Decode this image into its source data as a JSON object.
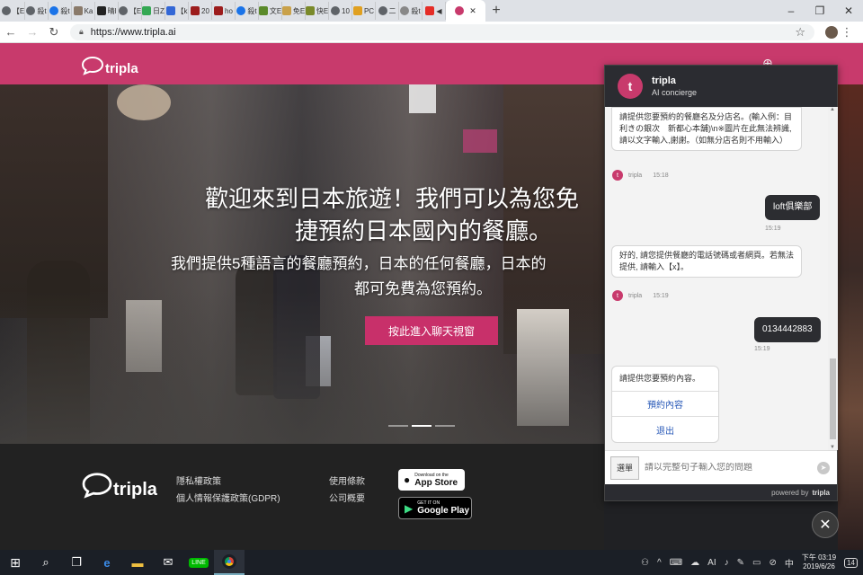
{
  "browser": {
    "tabs": [
      {
        "label": "【E",
        "icon": "chrome-icon",
        "color": "#5f6368"
      },
      {
        "label": "殺t",
        "icon": "chrome-icon",
        "color": "#5f6368"
      },
      {
        "label": "殺t",
        "icon": "globe-blue-icon",
        "color": "#1a73e8"
      },
      {
        "label": "Ka",
        "icon": "image-icon",
        "color": "#8a7a6a"
      },
      {
        "label": "晴l",
        "icon": "ufo-icon",
        "color": "#222222"
      },
      {
        "label": "【E",
        "icon": "chrome-icon",
        "color": "#5f6368"
      },
      {
        "label": "日Z",
        "icon": "drive-icon",
        "color": "#34a853"
      },
      {
        "label": "【k",
        "icon": "blue-square-icon",
        "color": "#3367d6"
      },
      {
        "label": "20",
        "icon": "red-square-icon",
        "color": "#9c1c1c"
      },
      {
        "label": "ho",
        "icon": "red-square-icon",
        "color": "#9c1c1c"
      },
      {
        "label": "殺t",
        "icon": "globe-blue-icon",
        "color": "#1a73e8"
      },
      {
        "label": "文E",
        "icon": "green-square-icon",
        "color": "#5a8a2a"
      },
      {
        "label": "免E",
        "icon": "flower-icon",
        "color": "#c9a14a"
      },
      {
        "label": "快E",
        "icon": "olive-square-icon",
        "color": "#7a8a2a"
      },
      {
        "label": "10",
        "icon": "chrome-icon",
        "color": "#5f6368"
      },
      {
        "label": "PC",
        "icon": "bars-icon",
        "color": "#e0a020"
      },
      {
        "label": "二",
        "icon": "chrome-icon",
        "color": "#5f6368"
      },
      {
        "label": "殺t",
        "icon": "globe-gray-icon",
        "color": "#888888"
      },
      {
        "label": "◀",
        "icon": "youtube-icon",
        "color": "#e52d27"
      }
    ],
    "active_tab_icon": "tripla-favicon",
    "url": "https://www.tripla.ai",
    "new_tab": "+",
    "window_minimize": "–",
    "window_maximize": "❐",
    "window_close": "✕"
  },
  "site": {
    "brand": "tripla",
    "accent": "#c83a6c",
    "hero_title_line1": "歡迎來到日本旅遊！我們可以為您免",
    "hero_title_line2": "捷預約日本國內的餐廳。",
    "hero_sub_line1": "我們提供5種語言的餐廳預約，日本的任何餐廳，日本的",
    "hero_sub_line2": "都可免費為您預約。",
    "cta_label": "按此進入聊天視窗"
  },
  "footer": {
    "brand": "tripla",
    "links_col1": [
      "隱私權政策",
      "個人情報保護政策(GDPR)"
    ],
    "links_col2": [
      "使用條款",
      "公司概要"
    ],
    "appstore_small": "Download on the",
    "appstore_big": "App Store",
    "googleplay_small": "GET IT ON",
    "googleplay_big": "Google Play"
  },
  "chat": {
    "name": "tripla",
    "role": "AI concierge",
    "avatar_letter": "t",
    "messages": {
      "bot1": "請提供您要預約的餐廳名及分店名。(輸入例：目利きの銀次　新都心本舗)\\n※圖片在此無法辨識, 請以文字輸入,謝謝。（如無分店名則不用輸入）",
      "bot1_sender": "tripla",
      "bot1_time": "15:18",
      "user1": "loft俱樂部",
      "user1_time": "15:19",
      "bot2": "好的, 請您提供餐廳的電話號碼或者網頁。若無法提供, 請輸入【x】。",
      "bot2_sender": "tripla",
      "bot2_time": "15:19",
      "user2": "0134442883",
      "user2_time": "15:19"
    },
    "options_prompt": "請提供您要預約內容。",
    "options": [
      "預約內容",
      "退出"
    ],
    "menu_label": "選單",
    "input_placeholder": "請以完整句子輸入您的問題",
    "powered_by": "powered by",
    "powered_brand": "tripla"
  },
  "taskbar": {
    "apps": [
      "windows-start-icon",
      "search-icon",
      "task-view-icon",
      "edge-icon",
      "file-explorer-icon",
      "mail-icon",
      "line-icon",
      "chrome-icon"
    ],
    "time": "下午 03:19",
    "date": "2019/6/26",
    "notifications": "14"
  }
}
